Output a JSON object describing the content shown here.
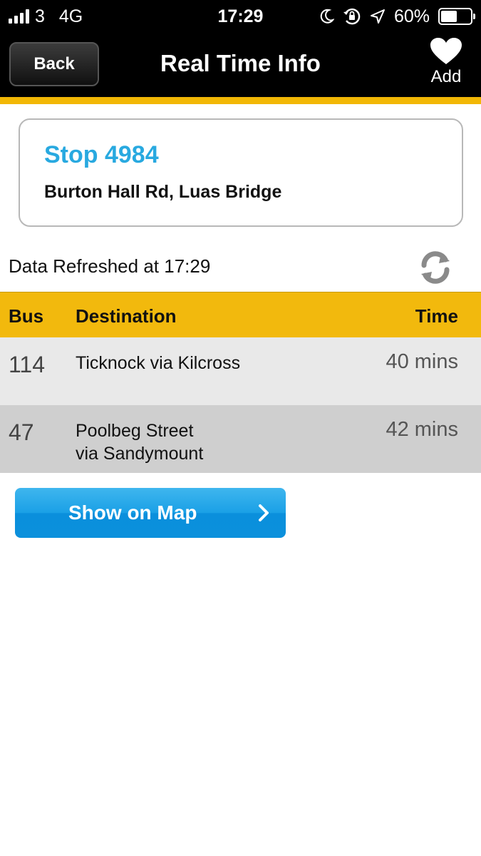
{
  "status_bar": {
    "carrier": "3",
    "network": "4G",
    "time": "17:29",
    "battery": "60%",
    "battery_level": 0.6
  },
  "nav": {
    "back_label": "Back",
    "title": "Real Time Info",
    "add_label": "Add"
  },
  "stop": {
    "number": "Stop 4984",
    "name": "Burton Hall Rd, Luas Bridge"
  },
  "refresh": {
    "text": "Data Refreshed at 17:29"
  },
  "table": {
    "headers": {
      "bus": "Bus",
      "destination": "Destination",
      "time": "Time"
    },
    "rows": [
      {
        "bus": "114",
        "destination_line1": "Ticknock via Kilcross",
        "destination_line2": "",
        "time": "40 mins"
      },
      {
        "bus": "47",
        "destination_line1": "Poolbeg Street",
        "destination_line2": "via Sandymount",
        "time": "42 mins"
      }
    ]
  },
  "map_button": {
    "label": "Show on Map"
  },
  "colors": {
    "accent_yellow": "#f2b90d",
    "stop_blue": "#28a9e0",
    "button_blue": "#1aa0e6"
  }
}
